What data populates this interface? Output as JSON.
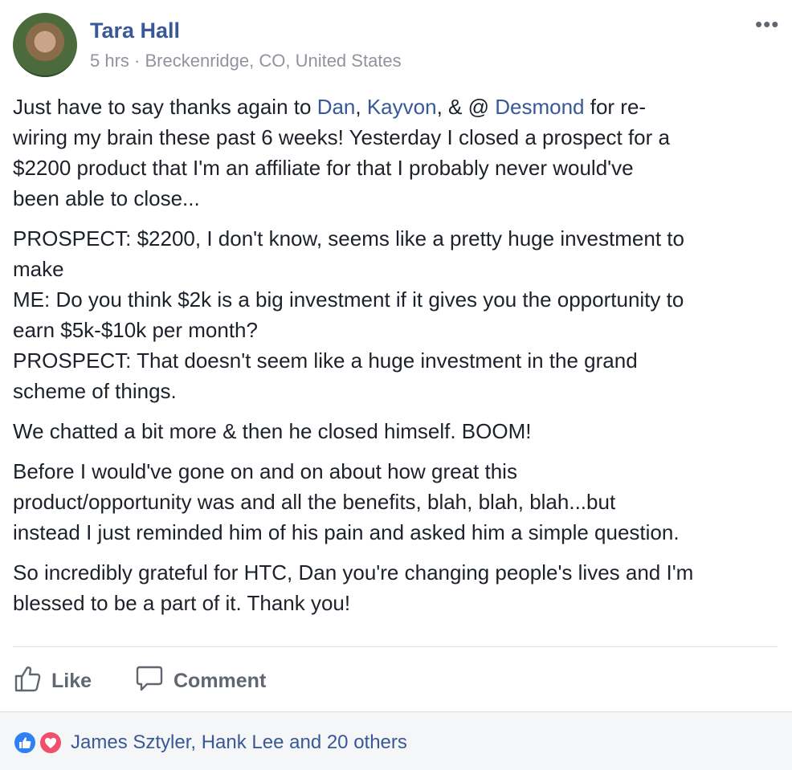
{
  "post": {
    "author": "Tara Hall",
    "time": "5 hrs",
    "separator": "·",
    "location": "Breckenridge, CO, United States",
    "more_label": "•••",
    "paragraphs": {
      "p1": {
        "l1_a": "Just have to say thanks again to ",
        "mention_1": "Dan",
        "l1_b": ", ",
        "mention_2": "Kayvon",
        "l1_c": ", & @ ",
        "mention_3": "Desmond",
        "l1_d": " for re-",
        "l2": "wiring my brain these past 6 weeks! Yesterday I closed a prospect for a",
        "l3": "$2200 product that I'm an affiliate for that I probably never would've",
        "l4": "been able to close..."
      },
      "p2": {
        "l1": "PROSPECT: $2200, I don't know, seems like a pretty huge investment to",
        "l2": "make",
        "l3": "ME: Do you think $2k is a big investment if it gives you the opportunity to",
        "l4": "earn $5k-$10k per month?",
        "l5": "PROSPECT: That doesn't seem like a huge investment in the grand",
        "l6": "scheme of things."
      },
      "p3": {
        "l1": "We chatted a bit more & then he closed himself. BOOM!"
      },
      "p4": {
        "l1": "Before I would've gone on and on about how great this",
        "l2": "product/opportunity was and all the benefits, blah, blah, blah...but",
        "l3": "instead I just reminded him of his pain and asked him a simple question."
      },
      "p5": {
        "l1": "So incredibly grateful for HTC, Dan you're changing people's lives and I'm",
        "l2": "blessed to be a part of it. Thank you!"
      }
    }
  },
  "actions": {
    "like_label": "Like",
    "comment_label": "Comment"
  },
  "reactions": {
    "icons": [
      "like-reaction-icon",
      "love-reaction-icon"
    ],
    "summary": "James Sztyler, Hank Lee and 20 others"
  },
  "colors": {
    "link": "#385898",
    "muted": "#90949c",
    "action": "#606770",
    "like": "#2e81f4",
    "love": "#f0506b"
  }
}
